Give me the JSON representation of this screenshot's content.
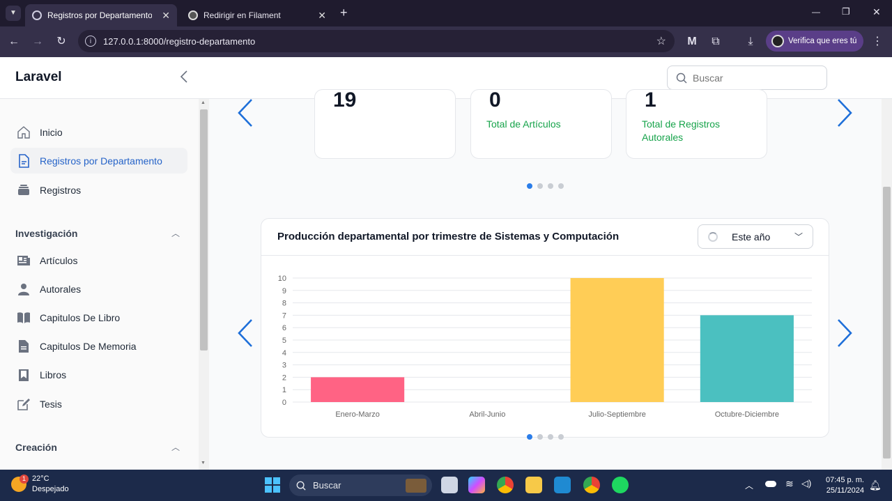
{
  "browser": {
    "tabs": [
      {
        "title": "Registros por Departamento - L",
        "active": true
      },
      {
        "title": "Redirigir en Filament",
        "active": false
      }
    ],
    "url": "127.0.0.1:8000/registro-departamento",
    "profile_label": "Verifica que eres tú",
    "new_tab_glyph": "+",
    "window_controls": {
      "minimize": "—",
      "maximize": "❐",
      "close": "✕"
    }
  },
  "app": {
    "brand": "Laravel",
    "search_placeholder": "Buscar"
  },
  "sidebar": {
    "items": [
      {
        "label": "Inicio",
        "icon": "home-icon",
        "active": false
      },
      {
        "label": "Registros por Departamento",
        "icon": "document-icon",
        "active": true
      },
      {
        "label": "Registros",
        "icon": "stack-icon",
        "active": false
      }
    ],
    "groups": [
      {
        "label": "Investigación",
        "items": [
          {
            "label": "Artículos",
            "icon": "newspaper-icon"
          },
          {
            "label": "Autorales",
            "icon": "user-icon"
          },
          {
            "label": "Capitulos De Libro",
            "icon": "open-book-icon"
          },
          {
            "label": "Capitulos De Memoria",
            "icon": "file-icon"
          },
          {
            "label": "Libros",
            "icon": "bookmark-icon"
          },
          {
            "label": "Tesis",
            "icon": "edit-icon"
          }
        ]
      },
      {
        "label": "Creación",
        "items": []
      }
    ]
  },
  "stats": [
    {
      "value": "19",
      "label": ""
    },
    {
      "value": "0",
      "label": "Total de Artículos"
    },
    {
      "value": "1",
      "label": "Total de Registros Autorales"
    }
  ],
  "carousel_top": {
    "dots": 4,
    "active": 0
  },
  "carousel_bottom": {
    "dots": 4,
    "active": 0
  },
  "chart_card": {
    "title": "Producción departamental por trimestre de Sistemas y Computación",
    "filter_value": "Este año"
  },
  "chart_data": {
    "type": "bar",
    "categories": [
      "Enero-Marzo",
      "Abril-Junio",
      "Julio-Septiembre",
      "Octubre-Diciembre"
    ],
    "values": [
      2,
      0,
      10,
      7
    ],
    "colors": [
      "#ff6384",
      "#36a2eb",
      "#ffcd56",
      "#4bc0c0"
    ],
    "ylim": [
      0,
      10
    ],
    "yticks": [
      0,
      1,
      2,
      3,
      4,
      5,
      6,
      7,
      8,
      9,
      10
    ],
    "grid": true,
    "title": "",
    "xlabel": "",
    "ylabel": ""
  },
  "taskbar": {
    "weather_temp": "22°C",
    "weather_desc": "Despejado",
    "weather_badge": "1",
    "search_label": "Buscar",
    "time": "07:45 p. m.",
    "date": "25/11/2024"
  }
}
